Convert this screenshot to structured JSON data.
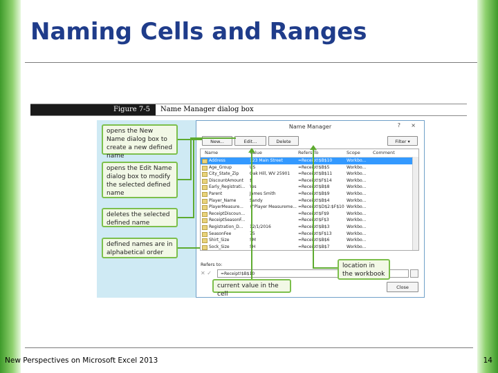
{
  "slide": {
    "title": "Naming Cells and Ranges",
    "footer": "New Perspectives on Microsoft Excel 2013",
    "page_number": "14"
  },
  "figure": {
    "label": "Figure 7-5",
    "caption": "Name Manager dialog box"
  },
  "callouts": {
    "new": "opens the New Name dialog box to create a new defined name",
    "edit": "opens the Edit Name dialog box to modify the selected defined name",
    "delete": "deletes the selected defined name",
    "alpha": "defined names are in alphabetical order",
    "location": "location in the workbook",
    "current": "current value in the cell"
  },
  "dialog": {
    "title": "Name Manager",
    "help": "?",
    "close_x": "×",
    "buttons": {
      "new": "New...",
      "edit": "Edit...",
      "delete": "Delete",
      "filter": "Filter ▾",
      "close": "Close"
    },
    "columns": [
      "Name",
      "Value",
      "Refers To",
      "Scope",
      "Comment"
    ],
    "rows": [
      {
        "name": "Address",
        "value": "123 Main Street",
        "refers": "=Receipt!$B$10",
        "scope": "Workbo..."
      },
      {
        "name": "Age_Group",
        "value": "US",
        "refers": "=Receipt!$B$5",
        "scope": "Workbo..."
      },
      {
        "name": "City_State_Zip",
        "value": "Oak Hill, WV 25901",
        "refers": "=Receipt!$B$11",
        "scope": "Workbo..."
      },
      {
        "name": "DiscountAmount",
        "value": "$",
        "refers": "=Receipt!$F$14",
        "scope": "Workbo..."
      },
      {
        "name": "Early_Registrati...",
        "value": "Yes",
        "refers": "=Receipt!$B$8",
        "scope": "Workbo..."
      },
      {
        "name": "Parent",
        "value": "James Smith",
        "refers": "=Receipt!$B$9",
        "scope": "Workbo..."
      },
      {
        "name": "Player_Name",
        "value": "Sandy",
        "refers": "=Receipt!$B$4",
        "scope": "Workbo..."
      },
      {
        "name": "PlayerMeasure...",
        "value": "{\"Player Measureme...",
        "refers": "=Receipt!$D$2:$F$10",
        "scope": "Workbo..."
      },
      {
        "name": "ReceiptDiscoun...",
        "value": "",
        "refers": "=Receipt!$F$9",
        "scope": "Workbo..."
      },
      {
        "name": "ReceiptSeasonF...",
        "value": "",
        "refers": "=Receipt!$F$3",
        "scope": "Workbo..."
      },
      {
        "name": "Registration_D...",
        "value": "12/1/2016",
        "refers": "=Receipt!$B$3",
        "scope": "Workbo..."
      },
      {
        "name": "SeasonFee",
        "value": "75",
        "refers": "=Receipt!$F$13",
        "scope": "Workbo..."
      },
      {
        "name": "Shirt_Size",
        "value": "SM",
        "refers": "=Receipt!$B$6",
        "scope": "Workbo..."
      },
      {
        "name": "Sock_Size",
        "value": "SH",
        "refers": "=Receipt!$B$7",
        "scope": "Workbo..."
      }
    ],
    "refers_to_label": "Refers to:",
    "refers_to_value": "=Receipt!$B$10",
    "refers_icons": "✕ ✓"
  },
  "colors": {
    "title": "#1f3c8a",
    "accent_green": "#5daa2f",
    "selection": "#3399ff"
  }
}
